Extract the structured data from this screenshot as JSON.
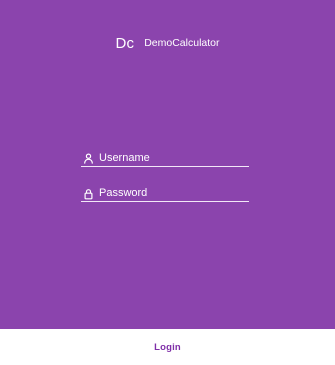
{
  "app": {
    "logo_text": "Dc",
    "title": "DemoCalculator"
  },
  "form": {
    "username": {
      "placeholder": "Username",
      "value": "",
      "icon": "user-icon"
    },
    "password": {
      "placeholder": "Password",
      "value": "",
      "icon": "lock-icon"
    }
  },
  "actions": {
    "login_label": "Login"
  },
  "colors": {
    "background": "#8b44ad",
    "bottom_bar": "#ffffff",
    "accent": "#7f2fa8",
    "text_on_background": "#ffffff"
  }
}
